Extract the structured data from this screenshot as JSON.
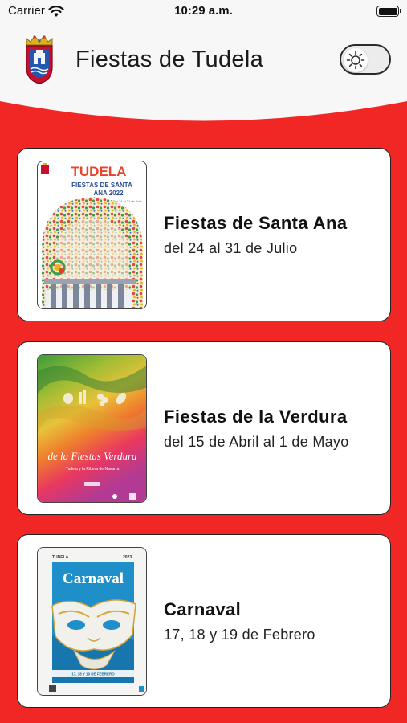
{
  "status_bar": {
    "carrier": "Carrier",
    "time": "10:29 a.m."
  },
  "header": {
    "title": "Fiestas de Tudela"
  },
  "events": [
    {
      "title": "Fiestas de Santa Ana",
      "dates": "del 24 al 31 de Julio",
      "poster": {
        "heading": "TUDELA",
        "line1": "FIESTAS DE SANTA",
        "line2": "ANA 2022",
        "note": "Del 24 al 31 de Julio"
      }
    },
    {
      "title": "Fiestas de la Verdura",
      "dates": "del 15 de Abril al 1 de Mayo",
      "poster": {
        "heading": "de la Fiestas Verdura",
        "subtitle": "Tudela y la Ribera de Navarra"
      }
    },
    {
      "title": "Carnaval",
      "dates": "17, 18 y 19 de Febrero",
      "poster": {
        "city": "TUDELA",
        "year": "2023",
        "heading": "Carnaval",
        "footer": "17, 18 Y 19 DE FEBRERO"
      }
    }
  ],
  "colors": {
    "background": "#f12726",
    "header": "#f7f7f7",
    "card": "#ffffff"
  },
  "icons": [
    "wifi-icon",
    "battery-icon",
    "coat-of-arms-icon",
    "sun-icon"
  ]
}
